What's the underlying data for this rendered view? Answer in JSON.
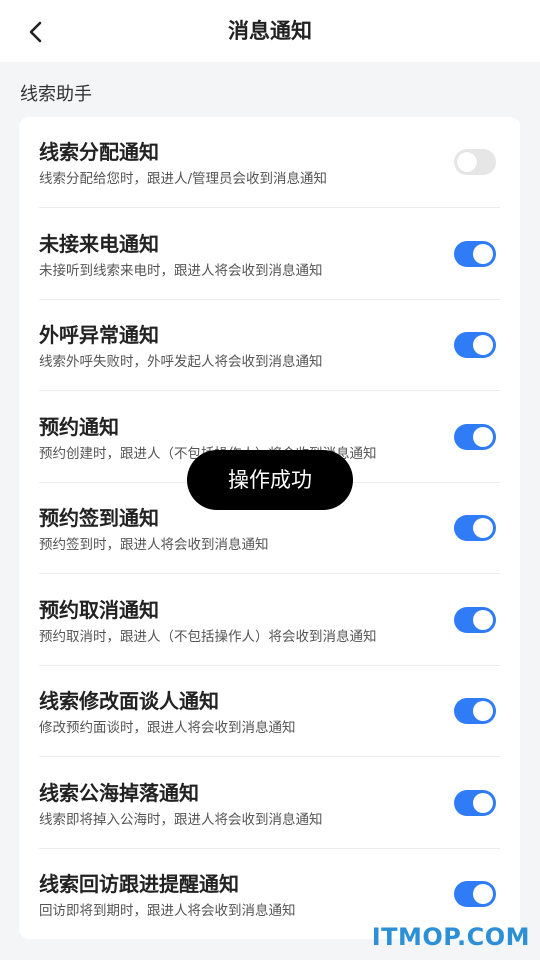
{
  "header": {
    "title": "消息通知"
  },
  "section": {
    "title": "线索助手"
  },
  "items": [
    {
      "title": "线索分配通知",
      "desc": "线索分配给您时，跟进人/管理员会收到消息通知",
      "enabled": false
    },
    {
      "title": "未接来电通知",
      "desc": "未接听到线索来电时，跟进人将会收到消息通知",
      "enabled": true
    },
    {
      "title": "外呼异常通知",
      "desc": "线索外呼失败时，外呼发起人将会收到消息通知",
      "enabled": true
    },
    {
      "title": "预约通知",
      "desc": "预约创建时，跟进人（不包括操作人）将会收到消息通知",
      "enabled": true
    },
    {
      "title": "预约签到通知",
      "desc": "预约签到时，跟进人将会收到消息通知",
      "enabled": true
    },
    {
      "title": "预约取消通知",
      "desc": "预约取消时，跟进人（不包括操作人）将会收到消息通知",
      "enabled": true
    },
    {
      "title": "线索修改面谈人通知",
      "desc": "修改预约面谈时，跟进人将会收到消息通知",
      "enabled": true
    },
    {
      "title": "线索公海掉落通知",
      "desc": "线索即将掉入公海时，跟进人将会收到消息通知",
      "enabled": true
    },
    {
      "title": "线索回访跟进提醒通知",
      "desc": "回访即将到期时，跟进人将会收到消息通知",
      "enabled": true
    }
  ],
  "toast": {
    "text": "操作成功"
  },
  "watermark": {
    "text": "ITMOP.COM"
  },
  "colors": {
    "accent": "#2f7cf6",
    "toggle_off": "#e6e6e6",
    "watermark": "#2d8fd6"
  }
}
